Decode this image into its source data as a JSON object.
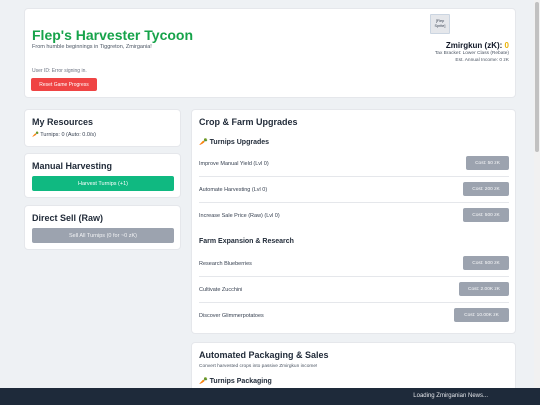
{
  "header": {
    "title": "Flep's Harvester Tycoon",
    "subtitle": "From humble beginnings in Tiggreton, Zmirgania!",
    "user_id": "User ID: Error signing in.",
    "reset_label": "Reset Game Progress",
    "sprite_label": "[Flep Sprite]",
    "currency_label": "Zmirgkun (zK):",
    "currency_value": "0",
    "tax_bracket": "Tax Bracket: Lower Class (Rebate)",
    "annual_income": "Est. Annual Income: 0 zK"
  },
  "resources": {
    "title": "My Resources",
    "turnips_line": "🥕 Turnips: 0 (Auto: 0.0/s)"
  },
  "manual": {
    "title": "Manual Harvesting",
    "button_label": "Harvest Turnips (+1)"
  },
  "direct_sell": {
    "title": "Direct Sell (Raw)",
    "button_label": "Sell All Turnips (0 for ~0 zK)"
  },
  "upgrades": {
    "title": "Crop & Farm Upgrades",
    "turnips_section": "🥕 Turnips Upgrades",
    "turnip_rows": [
      {
        "label": "Improve Manual Yield (Lvl 0)",
        "cost": "Cost: 50 zK"
      },
      {
        "label": "Automate Harvesting (Lvl 0)",
        "cost": "Cost: 200 zK"
      },
      {
        "label": "Increase Sale Price (Raw) (Lvl 0)",
        "cost": "Cost: 500 zK"
      }
    ],
    "expansion_section": "Farm Expansion & Research",
    "expansion_rows": [
      {
        "label": "Research Blueberries",
        "cost": "Cost: 500 zK"
      },
      {
        "label": "Cultivate Zucchini",
        "cost": "Cost: 2.00K zK"
      },
      {
        "label": "Discover Glimmerpotatoes",
        "cost": "Cost: 10.00K zK"
      }
    ]
  },
  "packaging": {
    "title": "Automated Packaging & Sales",
    "description": "Convert harvested crops into passive Zmirgkun income!",
    "turnips_section": "🥕 Turnips Packaging"
  },
  "footer": {
    "news": "Loading Zmirganian News..."
  }
}
